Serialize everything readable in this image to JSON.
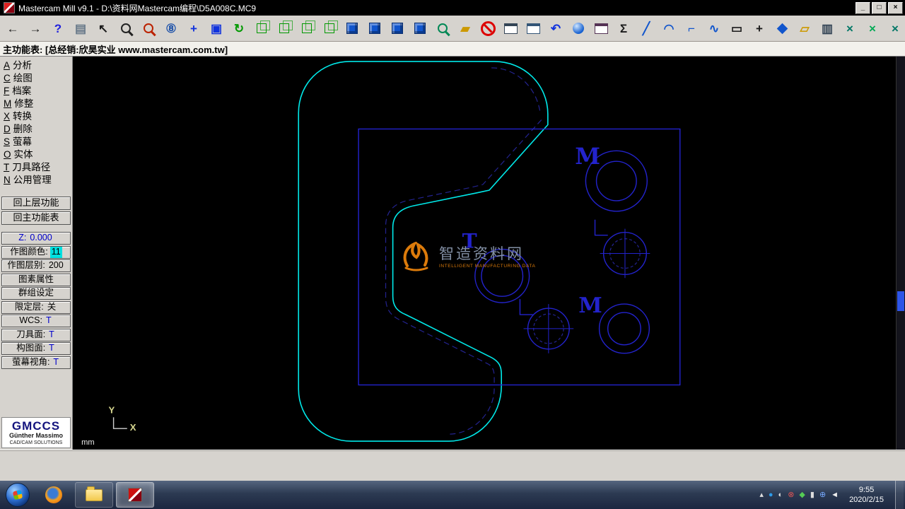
{
  "window": {
    "title": "Mastercam Mill v9.1 - D:\\资料网Mastercam编程\\D5A008C.MC9",
    "controls": {
      "minimize": "_",
      "maximize": "□",
      "close": "×"
    }
  },
  "menubar": {
    "text": "主功能表: [总经销:欣昊实业 www.mastercam.com.tw]"
  },
  "toolbar": {
    "items": [
      {
        "name": "back",
        "t": "glyph",
        "g": "←",
        "c": "#1a1a1a"
      },
      {
        "name": "forward",
        "t": "glyph",
        "g": "→",
        "c": "#1a1a1a"
      },
      {
        "name": "help",
        "t": "glyph",
        "g": "?",
        "c": "#2020dd"
      },
      {
        "name": "notepad",
        "t": "glyph",
        "g": "▤",
        "c": "#667788"
      },
      {
        "name": "pointer-help",
        "t": "glyph",
        "g": "↖",
        "c": "#1a1a1a"
      },
      {
        "name": "zoom-window",
        "t": "mag",
        "c": "#222222"
      },
      {
        "name": "zoom-target",
        "t": "mag",
        "c": "#bb2200"
      },
      {
        "name": "zoom-out-08",
        "t": "glyph",
        "g": "⑧",
        "c": "#2255aa"
      },
      {
        "name": "pan",
        "t": "glyph",
        "g": "+",
        "c": "#1133dd"
      },
      {
        "name": "fit-screen",
        "t": "glyph",
        "g": "▣",
        "c": "#1133dd"
      },
      {
        "name": "dynamic-view",
        "t": "glyph",
        "g": "↻",
        "c": "#009900"
      },
      {
        "name": "gview-isometric",
        "t": "cube",
        "c": "#009900"
      },
      {
        "name": "gview-top",
        "t": "cube",
        "c": "#009900"
      },
      {
        "name": "gview-front",
        "t": "cube",
        "c": "#009900"
      },
      {
        "name": "gview-side",
        "t": "cube",
        "c": "#009900"
      },
      {
        "name": "cplane-3d",
        "t": "scube",
        "c": "#1155cc"
      },
      {
        "name": "cplane-top",
        "t": "scube",
        "c": "#1155cc"
      },
      {
        "name": "cplane-front",
        "t": "scube",
        "c": "#1155cc"
      },
      {
        "name": "cplane-side",
        "t": "scube",
        "c": "#1155cc"
      },
      {
        "name": "view-magnify",
        "t": "mag",
        "c": "#008855"
      },
      {
        "name": "clear-colors",
        "t": "glyph",
        "g": "▰",
        "c": "#cc9900"
      },
      {
        "name": "delete",
        "t": "ban",
        "c": "#dd0000"
      },
      {
        "name": "screen-window",
        "t": "win",
        "c": "#334455"
      },
      {
        "name": "screen-combine",
        "t": "win",
        "c": "#335577"
      },
      {
        "name": "undo",
        "t": "glyph",
        "g": "↶",
        "c": "#1133dd"
      },
      {
        "name": "shade",
        "t": "ball",
        "c": "#1560d0"
      },
      {
        "name": "viewport",
        "t": "win",
        "c": "#553355"
      },
      {
        "name": "sigma",
        "t": "glyph",
        "g": "Σ",
        "c": "#1a1a1a"
      },
      {
        "name": "line",
        "t": "glyph",
        "g": "╱",
        "c": "#1155cc"
      },
      {
        "name": "arc",
        "t": "glyph",
        "g": "◠",
        "c": "#1155cc"
      },
      {
        "name": "fillet",
        "t": "glyph",
        "g": "⌐",
        "c": "#1155cc"
      },
      {
        "name": "spline",
        "t": "glyph",
        "g": "∿",
        "c": "#1155cc"
      },
      {
        "name": "rectangle",
        "t": "glyph",
        "g": "▭",
        "c": "#1a1a1a"
      },
      {
        "name": "point",
        "t": "glyph",
        "g": "+",
        "c": "#1a1a1a"
      },
      {
        "name": "xform",
        "t": "diamond",
        "c": "#1155cc"
      },
      {
        "name": "surface",
        "t": "glyph",
        "g": "▱",
        "c": "#cc9900"
      },
      {
        "name": "multi-edit",
        "t": "glyph",
        "g": "▥",
        "c": "#334455"
      },
      {
        "name": "trim-1",
        "t": "glyph",
        "g": "×",
        "c": "#007766"
      },
      {
        "name": "trim-2",
        "t": "glyph",
        "g": "×",
        "c": "#00aa55"
      },
      {
        "name": "trim-3",
        "t": "glyph",
        "g": "×",
        "c": "#007766"
      },
      {
        "name": "trim-4",
        "t": "glyph",
        "g": "×",
        "c": "#00aa55"
      }
    ]
  },
  "sidebar": {
    "menu_items": [
      {
        "name": "analyze",
        "hotkey": "A",
        "label": "分析"
      },
      {
        "name": "create",
        "hotkey": "C",
        "label": "绘图"
      },
      {
        "name": "file",
        "hotkey": "F",
        "label": "档案"
      },
      {
        "name": "modify",
        "hotkey": "M",
        "label": "修整"
      },
      {
        "name": "xform",
        "hotkey": "X",
        "label": "转换"
      },
      {
        "name": "delete",
        "hotkey": "D",
        "label": "删除"
      },
      {
        "name": "screen",
        "hotkey": "S",
        "label": "萤幕"
      },
      {
        "name": "solids",
        "hotkey": "O",
        "label": "实体"
      },
      {
        "name": "toolpaths",
        "hotkey": "T",
        "label": "刀具路径"
      },
      {
        "name": "nc-utils",
        "hotkey": "N",
        "label": "公用管理"
      }
    ],
    "nav_buttons": [
      {
        "name": "back-menu-button",
        "label": "回上层功能"
      },
      {
        "name": "main-menu-button",
        "label": "回主功能表"
      }
    ],
    "status_buttons": [
      {
        "name": "z-depth",
        "label": "Z:",
        "value": "0.000",
        "label_color": "#0000cc",
        "value_color": "#0000cc"
      },
      {
        "name": "draw-color",
        "label": "作图颜色:",
        "value": "11",
        "value_bg": "#00e0e0"
      },
      {
        "name": "draw-level",
        "label": "作图层别:",
        "value": "200"
      },
      {
        "name": "attributes",
        "label": "图素属性"
      },
      {
        "name": "groups",
        "label": "群组设定"
      },
      {
        "name": "level-mask",
        "label": "限定层:",
        "value": "关"
      },
      {
        "name": "wcs",
        "label": "WCS:",
        "value": "T",
        "value_color": "#0000cc"
      },
      {
        "name": "tool-plane",
        "label": "刀具面:",
        "value": "T",
        "value_color": "#0000cc"
      },
      {
        "name": "construction-plane",
        "label": "构图面:",
        "value": "T",
        "value_color": "#0000cc"
      },
      {
        "name": "graphics-view",
        "label": "萤幕视角:",
        "value": "T",
        "value_color": "#0000cc"
      }
    ],
    "logo": {
      "title": "GMCCS",
      "line1": "Günther Massimo",
      "line2": "CAD/CAM SOLUTIONS"
    }
  },
  "canvas": {
    "watermark": {
      "cn": "智造资料网",
      "en": "INTELLIGENT MANUFACTURING DATA"
    },
    "labels": {
      "m1": "M",
      "m2": "M",
      "t1": "T"
    },
    "axis_x": "X",
    "axis_y": "Y",
    "units": "mm",
    "colors": {
      "outline": "#00e8e8",
      "entity": "#2323cc",
      "dashed": "#23238f"
    }
  },
  "taskbar": {
    "tray_icons": [
      {
        "name": "hidden-icons",
        "g": "▴",
        "c": "#dddddd"
      },
      {
        "name": "notifier",
        "g": "●",
        "c": "#2d9ae8"
      },
      {
        "name": "network",
        "g": "◐",
        "c": "#dddddd"
      },
      {
        "name": "security",
        "g": "⊗",
        "c": "#dd5555"
      },
      {
        "name": "sync",
        "g": "◆",
        "c": "#55cc55"
      },
      {
        "name": "battery",
        "g": "▮",
        "c": "#dddddd"
      },
      {
        "name": "usb",
        "g": "⊕",
        "c": "#77aaff"
      },
      {
        "name": "volume",
        "g": "◄",
        "c": "#eeeeee"
      }
    ],
    "clock": {
      "time": "9:55",
      "date": "2020/2/15"
    }
  }
}
